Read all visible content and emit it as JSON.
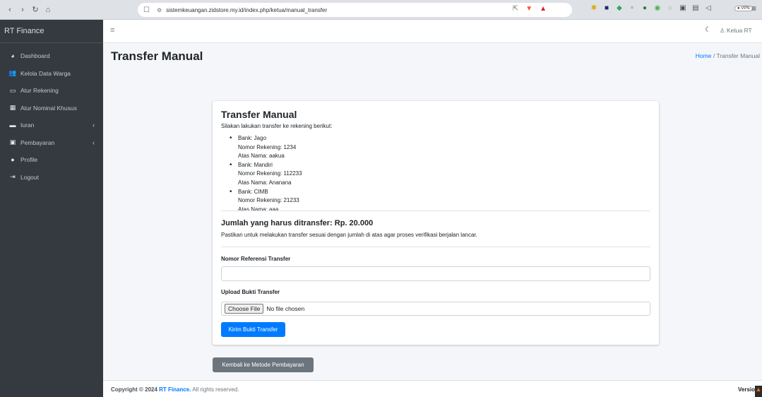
{
  "browser": {
    "url": "sistemkeuangan.zidstore.my.id/index.php/ketua/manual_transfer",
    "vpn_label": "VPN"
  },
  "sidebar": {
    "brand": "RT Finance",
    "items": [
      {
        "label": "Dashboard",
        "icon": "dashboard-icon"
      },
      {
        "label": "Kelola Data Warga",
        "icon": "users-icon"
      },
      {
        "label": "Atur Rekening",
        "icon": "credit-card-icon"
      },
      {
        "label": "Atur Nominal Khusus",
        "icon": "calculator-icon"
      },
      {
        "label": "Iuran",
        "icon": "money-icon"
      },
      {
        "label": "Pembayaran",
        "icon": "payment-icon"
      },
      {
        "label": "Profile",
        "icon": "user-icon"
      },
      {
        "label": "Logout",
        "icon": "logout-icon"
      }
    ]
  },
  "topbar": {
    "user": "Ketua RT"
  },
  "header": {
    "title": "Transfer Manual",
    "breadcrumb_home": "Home",
    "breadcrumb_sep": "/",
    "breadcrumb_current": "Transfer Manual"
  },
  "card": {
    "title": "Transfer Manual",
    "intro": "Silakan lakukan transfer ke rekening berikut:",
    "banks": [
      {
        "bank": "Bank: Jago",
        "number": "Nomor Rekening: 1234",
        "name": "Atas Nama: aakua"
      },
      {
        "bank": "Bank: Mandiri",
        "number": "Nomor Rekening: 112233",
        "name": "Atas Nama: Ananana"
      },
      {
        "bank": "Bank: CIMB",
        "number": "Nomor Rekening: 21233",
        "name": "Atas Nama: aaa"
      }
    ],
    "amount": "Jumlah yang harus ditransfer: Rp. 20.000",
    "note": "Pastikan untuk melakukan transfer sesuai dengan jumlah di atas agar proses verifikasi berjalan lancar.",
    "ref_label": "Nomor Referensi Transfer",
    "ref_value": "",
    "upload_label": "Upload Bukti Transfer",
    "choose_file": "Choose File",
    "no_file": "No file chosen",
    "submit": "Kirim Bukti Transfer"
  },
  "back_button": "Kembali ke Metode Pembayaran",
  "footer": {
    "prefix": "Copyright © 2024 ",
    "brand": "RT Finance.",
    "suffix": " All rights reserved.",
    "version": "Versio"
  }
}
